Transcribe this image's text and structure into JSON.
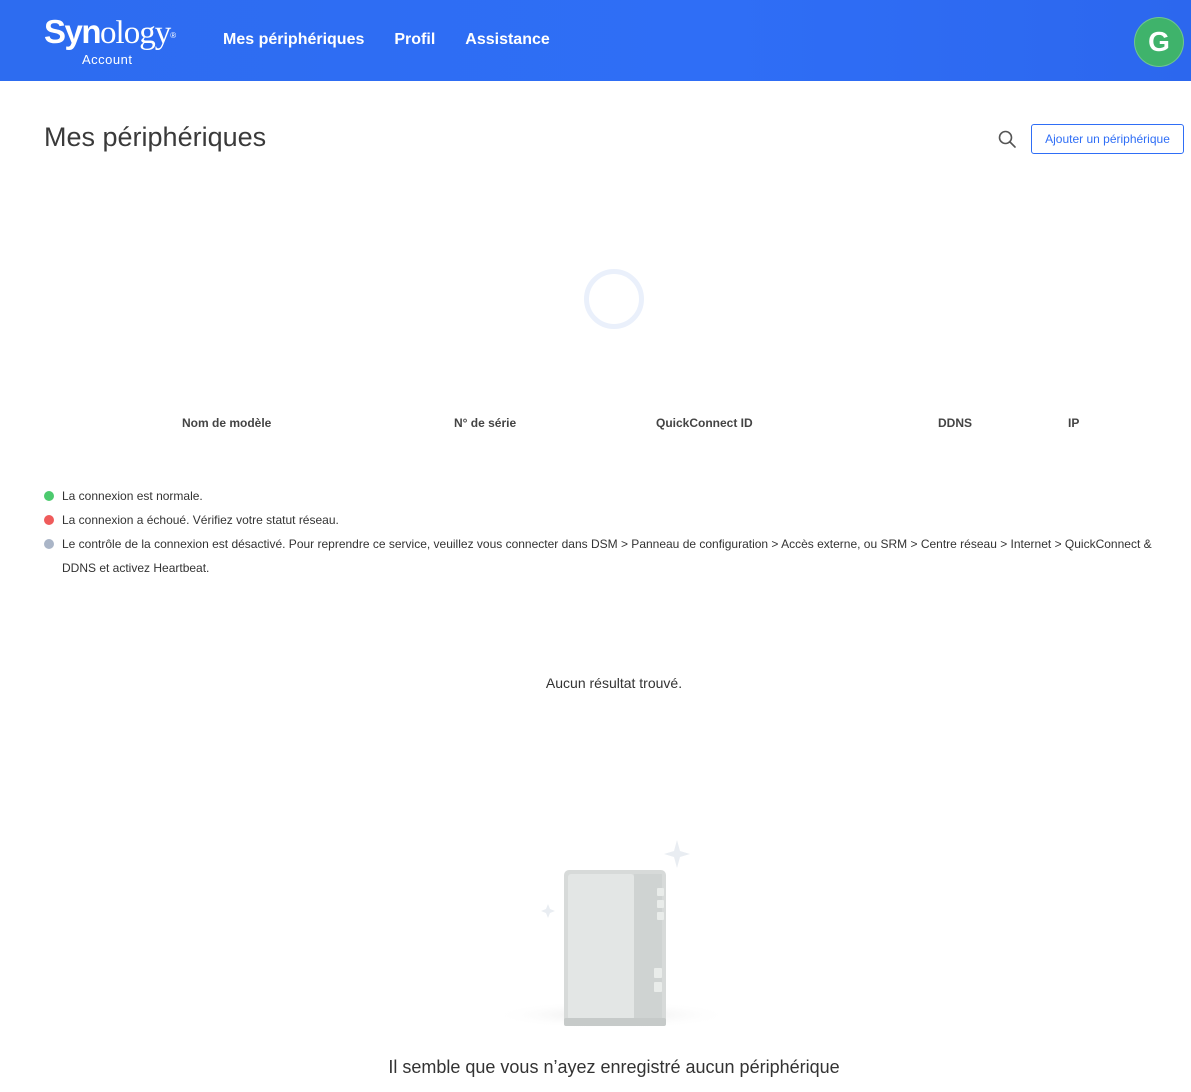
{
  "header": {
    "logo_primary_bold": "Syn",
    "logo_primary_light": "ology",
    "logo_registered": "®",
    "logo_sub": "Account",
    "nav": [
      {
        "label": "Mes périphériques"
      },
      {
        "label": "Profil"
      },
      {
        "label": "Assistance"
      }
    ],
    "avatar_letter": "G",
    "colors": {
      "bar": "#2d6cf0",
      "avatar": "#3fb36b"
    }
  },
  "main": {
    "title": "Mes périphériques",
    "search_icon": "search-icon",
    "add_button_label": "Ajouter un périphérique",
    "loading_icon": "loading-spinner-icon",
    "table": {
      "columns": [
        "Nom de modèle",
        "N° de série",
        "QuickConnect ID",
        "DDNS",
        "IP"
      ]
    },
    "legend": [
      {
        "color": "#4cca6e",
        "text": "La connexion est normale."
      },
      {
        "color": "#ef5b5b",
        "text": "La connexion a échoué. Vérifiez votre statut réseau."
      },
      {
        "color": "#aab5c7",
        "text": "Le contrôle de la connexion est désactivé. Pour reprendre ce service, veuillez vous connecter dans DSM > Panneau de configuration > Accès externe, ou SRM > Centre réseau > Internet > QuickConnect & DDNS et activez Heartbeat."
      }
    ],
    "no_results": "Aucun résultat trouvé.",
    "empty_illustration_icon": "nas-device-icon",
    "empty_title": "Il semble que vous n’ayez enregistré aucun périphérique"
  }
}
